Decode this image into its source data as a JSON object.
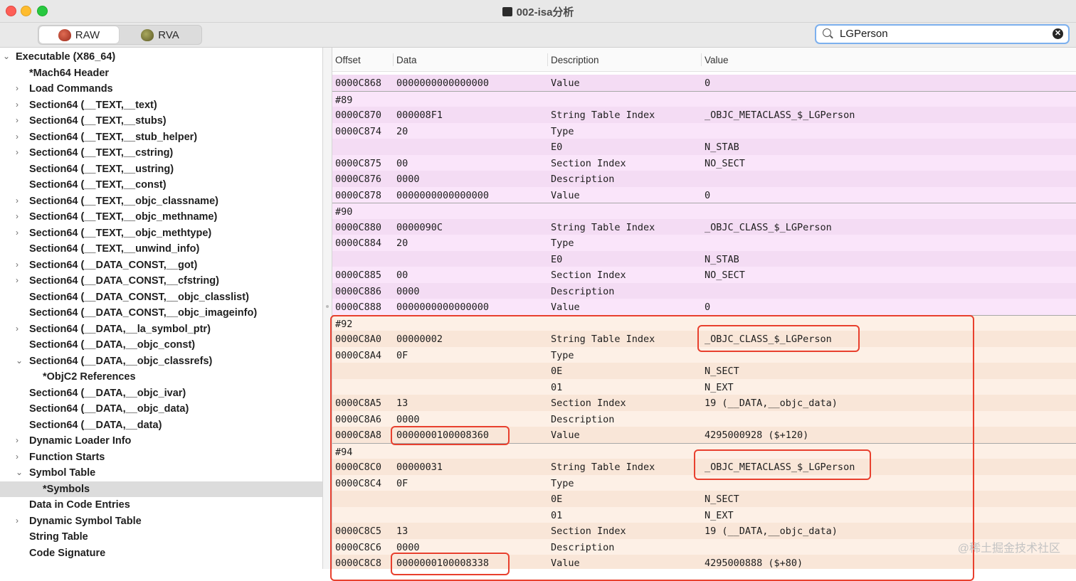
{
  "window": {
    "title": "002-isa分析"
  },
  "toolbar": {
    "raw_label": "RAW",
    "rva_label": "RVA",
    "search": {
      "value": "LGPerson"
    }
  },
  "sidebar": {
    "items": [
      {
        "label": "Executable  (X86_64)",
        "chevron": "v"
      },
      {
        "label": "*Mach64 Header",
        "chevron": ""
      },
      {
        "label": "Load Commands",
        "chevron": ">"
      },
      {
        "label": "Section64 (__TEXT,__text)",
        "chevron": ">"
      },
      {
        "label": "Section64 (__TEXT,__stubs)",
        "chevron": ">"
      },
      {
        "label": "Section64 (__TEXT,__stub_helper)",
        "chevron": ">"
      },
      {
        "label": "Section64 (__TEXT,__cstring)",
        "chevron": ">"
      },
      {
        "label": "Section64 (__TEXT,__ustring)",
        "chevron": ""
      },
      {
        "label": "Section64 (__TEXT,__const)",
        "chevron": ""
      },
      {
        "label": "Section64 (__TEXT,__objc_classname)",
        "chevron": ">"
      },
      {
        "label": "Section64 (__TEXT,__objc_methname)",
        "chevron": ">"
      },
      {
        "label": "Section64 (__TEXT,__objc_methtype)",
        "chevron": ">"
      },
      {
        "label": "Section64 (__TEXT,__unwind_info)",
        "chevron": ""
      },
      {
        "label": "Section64 (__DATA_CONST,__got)",
        "chevron": ">"
      },
      {
        "label": "Section64 (__DATA_CONST,__cfstring)",
        "chevron": ">"
      },
      {
        "label": "Section64 (__DATA_CONST,__objc_classlist)",
        "chevron": ""
      },
      {
        "label": "Section64 (__DATA_CONST,__objc_imageinfo)",
        "chevron": ""
      },
      {
        "label": "Section64 (__DATA,__la_symbol_ptr)",
        "chevron": ">"
      },
      {
        "label": "Section64 (__DATA,__objc_const)",
        "chevron": ""
      },
      {
        "label": "Section64 (__DATA,__objc_classrefs)",
        "chevron": "v"
      },
      {
        "label": "*ObjC2 References",
        "chevron": ""
      },
      {
        "label": "Section64 (__DATA,__objc_ivar)",
        "chevron": ""
      },
      {
        "label": "Section64 (__DATA,__objc_data)",
        "chevron": ""
      },
      {
        "label": "Section64 (__DATA,__data)",
        "chevron": ""
      },
      {
        "label": "Dynamic Loader Info",
        "chevron": ">"
      },
      {
        "label": "Function Starts",
        "chevron": ">"
      },
      {
        "label": "Symbol Table",
        "chevron": "v"
      },
      {
        "label": "*Symbols",
        "chevron": ""
      },
      {
        "label": "Data in Code Entries",
        "chevron": ""
      },
      {
        "label": "Dynamic Symbol Table",
        "chevron": ">"
      },
      {
        "label": "String Table",
        "chevron": ""
      },
      {
        "label": "Code Signature",
        "chevron": ""
      }
    ]
  },
  "table": {
    "columns": [
      "Offset",
      "Data",
      "Description",
      "Value"
    ],
    "rows": [
      {
        "offset": "0000C868",
        "data": "0000000000000000",
        "desc": "Value",
        "value": "0",
        "group": "pink"
      },
      {
        "offset": "#89",
        "data": "",
        "desc": "",
        "value": "",
        "group": "pink"
      },
      {
        "offset": "0000C870",
        "data": "000008F1",
        "desc": "String Table Index",
        "value": "_OBJC_METACLASS_$_LGPerson",
        "group": "pink"
      },
      {
        "offset": "0000C874",
        "data": "20",
        "desc": "Type",
        "value": "",
        "group": "pink"
      },
      {
        "offset": "",
        "data": "",
        "desc": "E0",
        "value": "N_STAB",
        "group": "pink"
      },
      {
        "offset": "0000C875",
        "data": "00",
        "desc": "Section Index",
        "value": "NO_SECT",
        "group": "pink"
      },
      {
        "offset": "0000C876",
        "data": "0000",
        "desc": "Description",
        "value": "",
        "group": "pink"
      },
      {
        "offset": "0000C878",
        "data": "0000000000000000",
        "desc": "Value",
        "value": "0",
        "group": "pink"
      },
      {
        "offset": "#90",
        "data": "",
        "desc": "",
        "value": "",
        "group": "pink"
      },
      {
        "offset": "0000C880",
        "data": "0000090C",
        "desc": "String Table Index",
        "value": "_OBJC_CLASS_$_LGPerson",
        "group": "pink"
      },
      {
        "offset": "0000C884",
        "data": "20",
        "desc": "Type",
        "value": "",
        "group": "pink"
      },
      {
        "offset": "",
        "data": "",
        "desc": "E0",
        "value": "N_STAB",
        "group": "pink"
      },
      {
        "offset": "0000C885",
        "data": "00",
        "desc": "Section Index",
        "value": "NO_SECT",
        "group": "pink"
      },
      {
        "offset": "0000C886",
        "data": "0000",
        "desc": "Description",
        "value": "",
        "group": "pink"
      },
      {
        "offset": "0000C888",
        "data": "0000000000000000",
        "desc": "Value",
        "value": "0",
        "group": "pink"
      },
      {
        "offset": "#92",
        "data": "",
        "desc": "",
        "value": "",
        "group": "peach"
      },
      {
        "offset": "0000C8A0",
        "data": "00000002",
        "desc": "String Table Index",
        "value": "_OBJC_CLASS_$_LGPerson",
        "group": "peach"
      },
      {
        "offset": "0000C8A4",
        "data": "0F",
        "desc": "Type",
        "value": "",
        "group": "peach"
      },
      {
        "offset": "",
        "data": "",
        "desc": "0E",
        "value": "N_SECT",
        "group": "peach"
      },
      {
        "offset": "",
        "data": "",
        "desc": "01",
        "value": "N_EXT",
        "group": "peach"
      },
      {
        "offset": "0000C8A5",
        "data": "13",
        "desc": "Section Index",
        "value": "19 (__DATA,__objc_data)",
        "group": "peach"
      },
      {
        "offset": "0000C8A6",
        "data": "0000",
        "desc": "Description",
        "value": "",
        "group": "peach"
      },
      {
        "offset": "0000C8A8",
        "data": "0000000100008360",
        "desc": "Value",
        "value": "4295000928 ($+120)",
        "group": "peach"
      },
      {
        "offset": "#94",
        "data": "",
        "desc": "",
        "value": "",
        "group": "peach"
      },
      {
        "offset": "0000C8C0",
        "data": "00000031",
        "desc": "String Table Index",
        "value": "_OBJC_METACLASS_$_LGPerson",
        "group": "peach"
      },
      {
        "offset": "0000C8C4",
        "data": "0F",
        "desc": "Type",
        "value": "",
        "group": "peach"
      },
      {
        "offset": "",
        "data": "",
        "desc": "0E",
        "value": "N_SECT",
        "group": "peach"
      },
      {
        "offset": "",
        "data": "",
        "desc": "01",
        "value": "N_EXT",
        "group": "peach"
      },
      {
        "offset": "0000C8C5",
        "data": "13",
        "desc": "Section Index",
        "value": "19 (__DATA,__objc_data)",
        "group": "peach"
      },
      {
        "offset": "0000C8C6",
        "data": "0000",
        "desc": "Description",
        "value": "",
        "group": "peach"
      },
      {
        "offset": "0000C8C8",
        "data": "0000000100008338",
        "desc": "Value",
        "value": "4295000888 ($+80)",
        "group": "peach"
      }
    ]
  },
  "watermark": "@稀土掘金技术社区"
}
